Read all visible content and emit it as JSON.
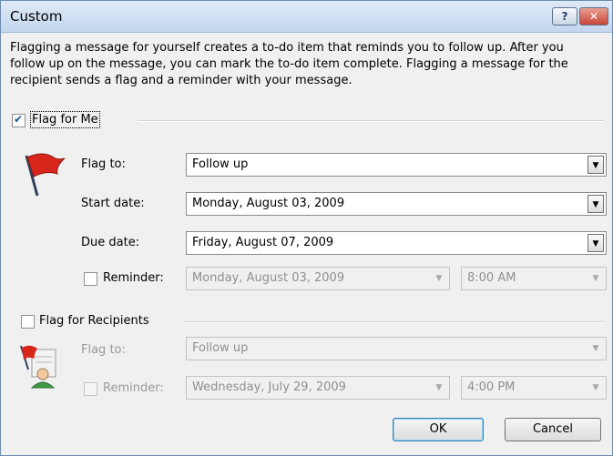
{
  "window": {
    "title": "Custom",
    "help_label": "?",
    "close_label": "✕"
  },
  "description": "Flagging a message for yourself creates a to-do item that reminds you to follow up. After you follow up on the message, you can mark the to-do item complete. Flagging a message for the recipient sends a flag and a reminder with your message.",
  "flag_for_me": {
    "checked": true,
    "label": "Flag for Me",
    "flag_to": {
      "label": "Flag to:",
      "value": "Follow up"
    },
    "start_date": {
      "label": "Start date:",
      "value": "Monday, August 03, 2009"
    },
    "due_date": {
      "label": "Due date:",
      "value": "Friday, August 07, 2009"
    },
    "reminder": {
      "checked": false,
      "label": "Reminder:",
      "date": "Monday, August 03, 2009",
      "time": "8:00 AM"
    }
  },
  "flag_for_recipients": {
    "checked": false,
    "label": "Flag for Recipients",
    "flag_to": {
      "label": "Flag to:",
      "value": "Follow up"
    },
    "reminder": {
      "checked": false,
      "label": "Reminder:",
      "date": "Wednesday, July 29, 2009",
      "time": "4:00 PM"
    }
  },
  "buttons": {
    "ok": "OK",
    "cancel": "Cancel"
  },
  "icons": {
    "flag": "red-flag-icon",
    "recipient": "recipient-flag-icon",
    "dropdown": "chevron-down-icon"
  },
  "colors": {
    "flag_red": "#d8261d",
    "accent_border": "#3c7fb1"
  }
}
